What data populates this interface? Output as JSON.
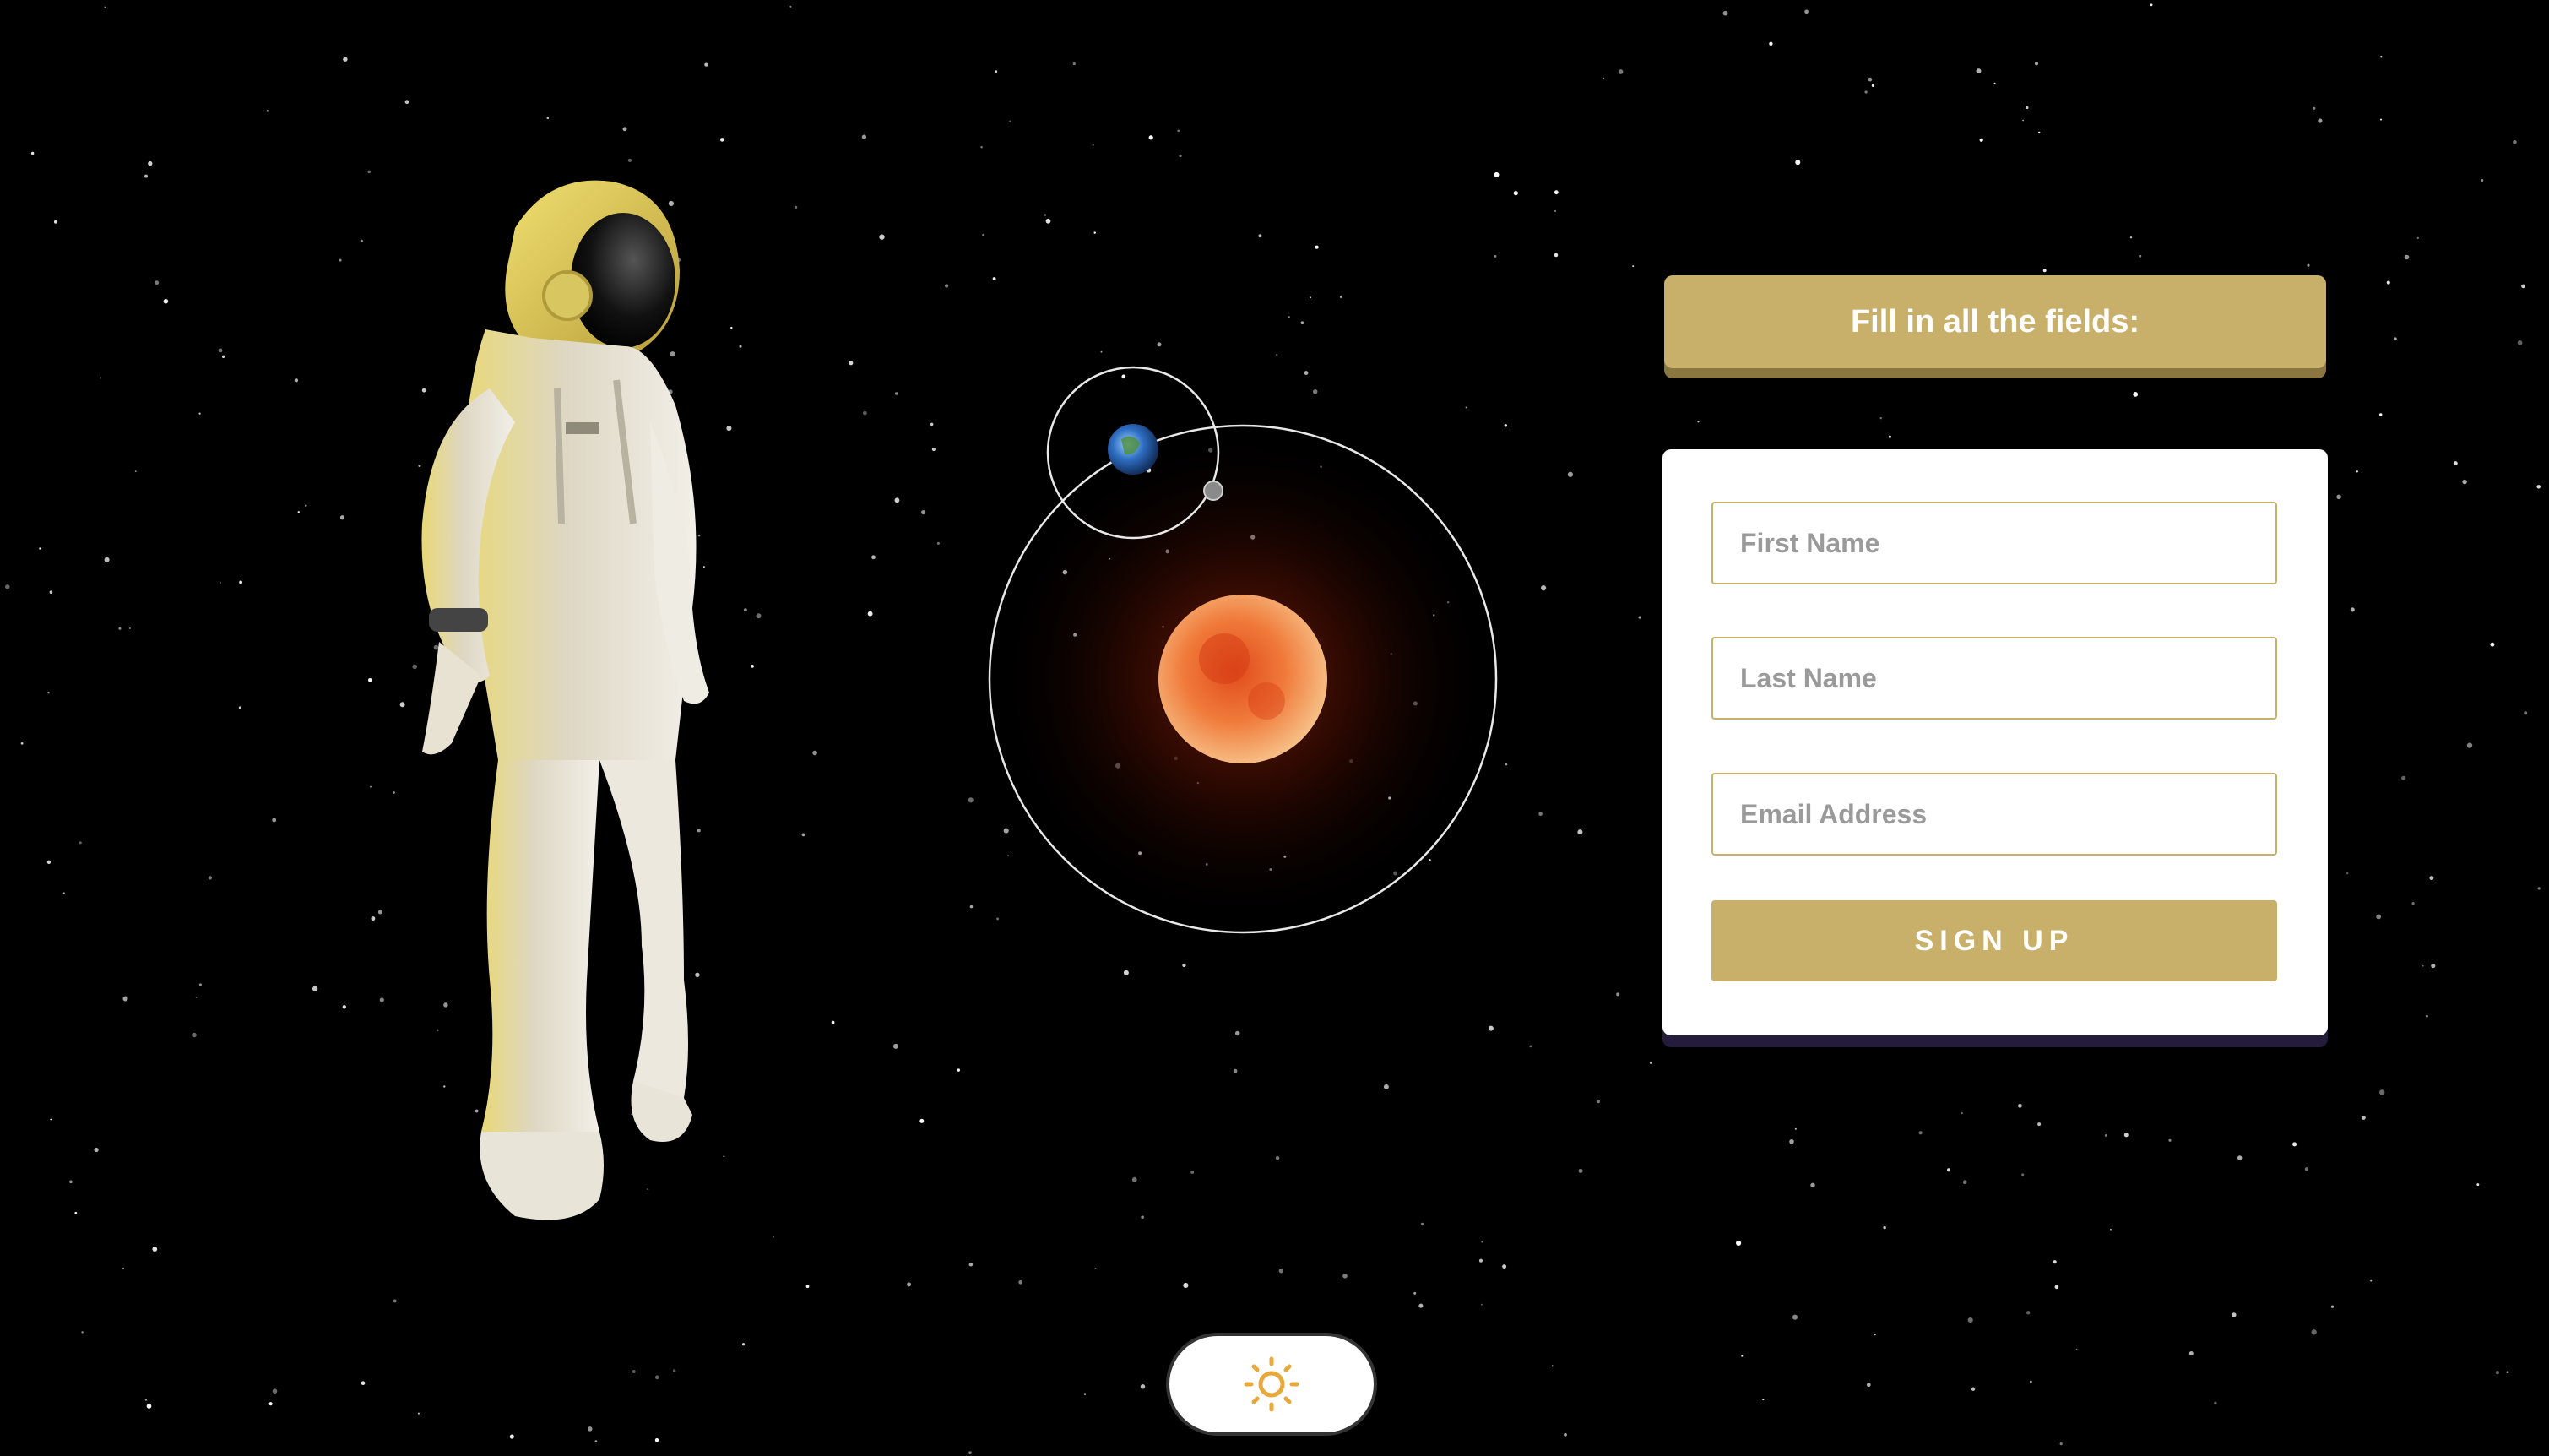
{
  "banner": {
    "text": "Fill in all the fields:"
  },
  "form": {
    "first_name_placeholder": "First Name",
    "last_name_placeholder": "Last Name",
    "email_placeholder": "Email Address",
    "submit_label": "SIGN UP"
  },
  "theme_toggle": {
    "icon": "sun-icon"
  },
  "illustrations": {
    "left": "astronaut",
    "center": "solar-system",
    "center_bodies": [
      "sun",
      "earth",
      "moon"
    ]
  },
  "colors": {
    "background": "#000000",
    "accent_gold": "#c9b06a",
    "card": "#ffffff",
    "sun_icon": "#e8a93a"
  }
}
